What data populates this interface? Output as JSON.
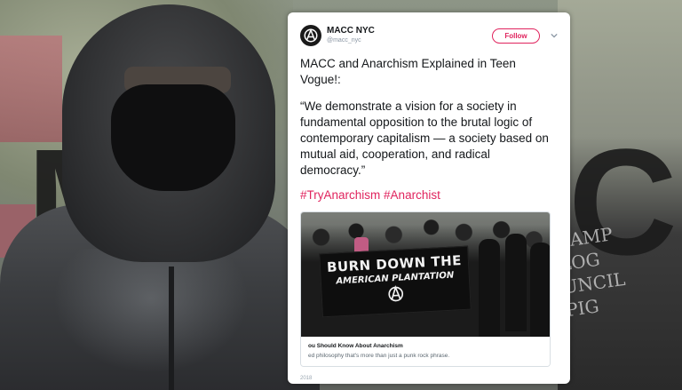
{
  "background": {
    "big_letters": [
      "M",
      "C"
    ],
    "chalk_text": [
      "CAMP",
      "LOG",
      "UNCIL",
      "PIG"
    ]
  },
  "tweet": {
    "display_name": "MACC NYC",
    "handle": "@macc_nyc",
    "follow_label": "Follow",
    "body_line": "MACC and Anarchism Explained in Teen Vogue!:",
    "quote": "“We demonstrate a vision for a society in fundamental opposition to the brutal logic of contemporary capitalism — a society based on mutual aid, cooperation, and radical democracy.”",
    "hashtags": [
      "#TryAnarchism",
      "#Anarchist"
    ],
    "card": {
      "banner_line1": "BURN DOWN THE",
      "banner_line2": "AMERICAN PLANTATION",
      "title": "ou Should Know About Anarchism",
      "description": "ed philosophy that's more than just a punk rock phrase."
    },
    "timestamp": "2018",
    "colors": {
      "accent": "#e0245e",
      "text": "#14171a",
      "muted": "#8a96a3"
    }
  }
}
